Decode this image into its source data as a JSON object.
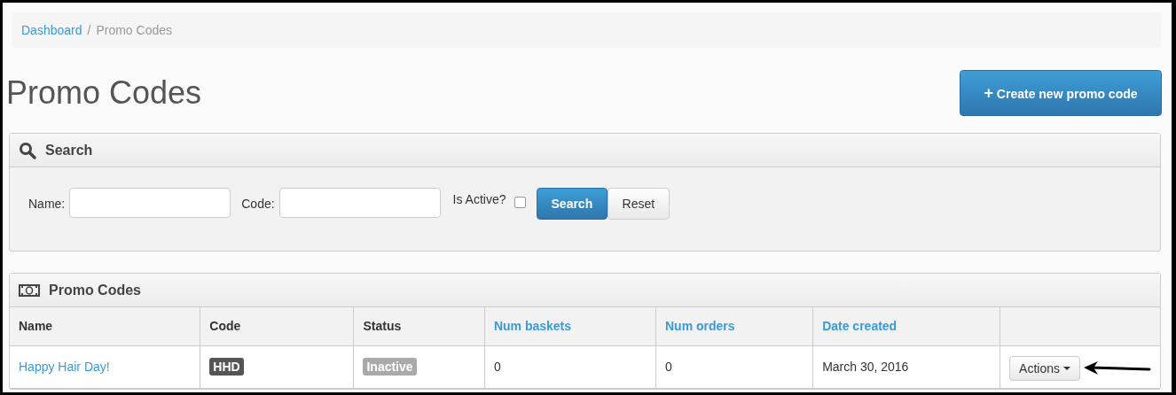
{
  "breadcrumb": [
    {
      "label": "Dashboard",
      "current": false
    },
    {
      "label": "Promo Codes",
      "current": true
    }
  ],
  "breadcrumb_separator": "/",
  "page_title": "Promo Codes",
  "create_button": {
    "icon": "+",
    "label": "Create new promo code"
  },
  "search_panel": {
    "title": "Search",
    "fields": [
      {
        "label": "Name:"
      },
      {
        "label": "Code:"
      }
    ],
    "active_filter": {
      "label": "Is Active?",
      "checked": false
    },
    "buttons": [
      {
        "label": "Search",
        "primary": true
      },
      {
        "label": "Reset",
        "primary": false
      }
    ]
  },
  "table_panel": {
    "title": "Promo Codes",
    "columns": [
      {
        "label": "Name",
        "sortable": false
      },
      {
        "label": "Code",
        "sortable": false
      },
      {
        "label": "Status",
        "sortable": false
      },
      {
        "label": "Num baskets",
        "sortable": true
      },
      {
        "label": "Num orders",
        "sortable": true
      },
      {
        "label": "Date created",
        "sortable": true
      }
    ],
    "rows": [
      {
        "name": "Happy Hair Day!",
        "code": "HHD",
        "status": {
          "label": "Inactive",
          "active": false
        },
        "num_baskets": "0",
        "num_orders": "0",
        "date_created": "March 30, 2016",
        "action": "Actions"
      }
    ]
  }
}
